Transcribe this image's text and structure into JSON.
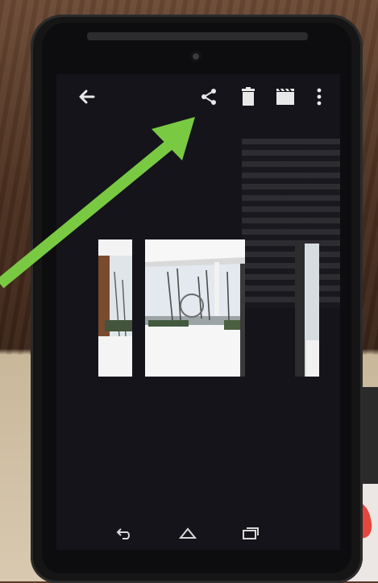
{
  "scene": {
    "subject": "phone",
    "annotation_color": "#7ac943"
  },
  "action_bar": {
    "icons": [
      "back-icon",
      "share-icon",
      "trash-icon",
      "film-icon",
      "overflow-menu-icon"
    ],
    "icon_color": "#e8e8e8"
  },
  "gallery": {
    "thumbnail_count": 3
  },
  "nav_bar": {
    "icons": [
      "nav-back-icon",
      "nav-home-icon",
      "nav-recent-apps-icon"
    ]
  }
}
